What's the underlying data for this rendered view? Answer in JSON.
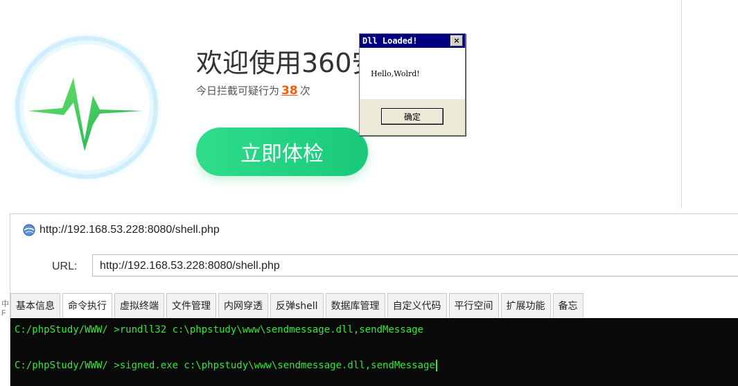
{
  "security_app": {
    "welcome_title": "欢迎使用360安",
    "intercept_prefix": "今日拦截可疑行为",
    "intercept_count": "38",
    "intercept_suffix": "次",
    "scan_button": "立即体检",
    "accent_color": "#19c97a",
    "count_color": "#ff5a00"
  },
  "dialog": {
    "title": "Dll Loaded!",
    "close_glyph": "×",
    "message": "Hello,Wolrd!",
    "ok_label": "确定"
  },
  "shell_manager": {
    "window_title": "http://192.168.53.228:8080/shell.php",
    "url_label": "URL:",
    "url_value": "http://192.168.53.228:8080/shell.php",
    "tabs": [
      {
        "label": "基本信息"
      },
      {
        "label": "命令执行"
      },
      {
        "label": "虚拟终端"
      },
      {
        "label": "文件管理"
      },
      {
        "label": "内网穿透"
      },
      {
        "label": "反弹shell"
      },
      {
        "label": "数据库管理"
      },
      {
        "label": "自定义代码"
      },
      {
        "label": "平行空间"
      },
      {
        "label": "扩展功能"
      },
      {
        "label": "备忘"
      }
    ],
    "terminal_lines": [
      "C:/phpStudy/WWW/ >rundll32 c:\\phpstudy\\www\\sendmessage.dll,sendMessage",
      "C:/phpStudy/WWW/ >signed.exe c:\\phpstudy\\www\\sendmessage.dll,sendMessage"
    ],
    "terminal_color": "#34e83a"
  },
  "edge_marks": [
    "中",
    "F"
  ]
}
